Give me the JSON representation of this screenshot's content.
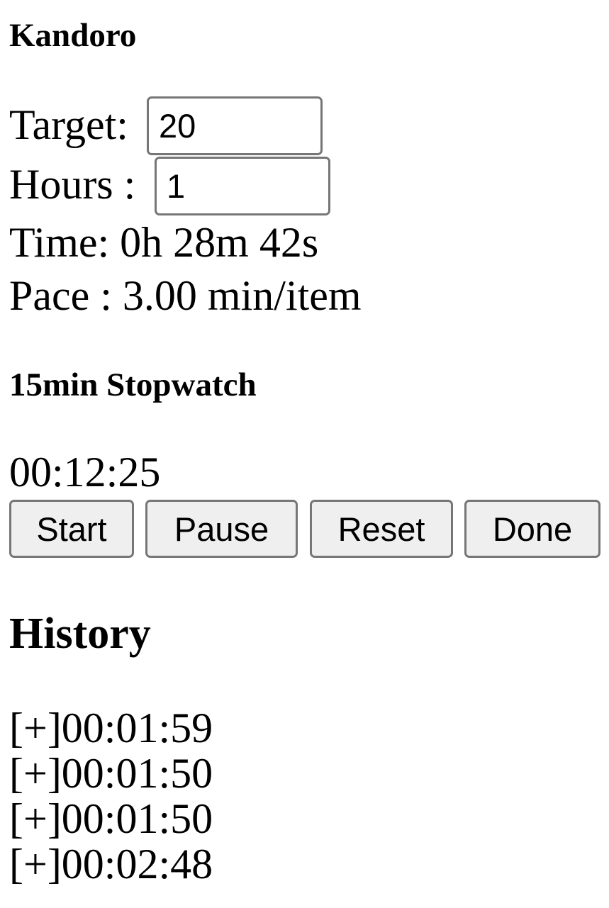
{
  "app": {
    "title": "Kandoro"
  },
  "form": {
    "target_label": "Target:",
    "target_value": "20",
    "hours_label": "Hours :",
    "hours_value": "1"
  },
  "stats": {
    "time_text": "Time: 0h 28m 42s",
    "pace_text": "Pace : 3.00 min/item"
  },
  "stopwatch": {
    "title": "15min Stopwatch",
    "display": "00:12:25",
    "buttons": {
      "start": "Start",
      "pause": "Pause",
      "reset": "Reset",
      "done": "Done"
    }
  },
  "history": {
    "title": "History",
    "items": [
      "[+]00:01:59",
      "[+]00:01:50",
      "[+]00:01:50",
      "[+]00:02:48"
    ]
  }
}
